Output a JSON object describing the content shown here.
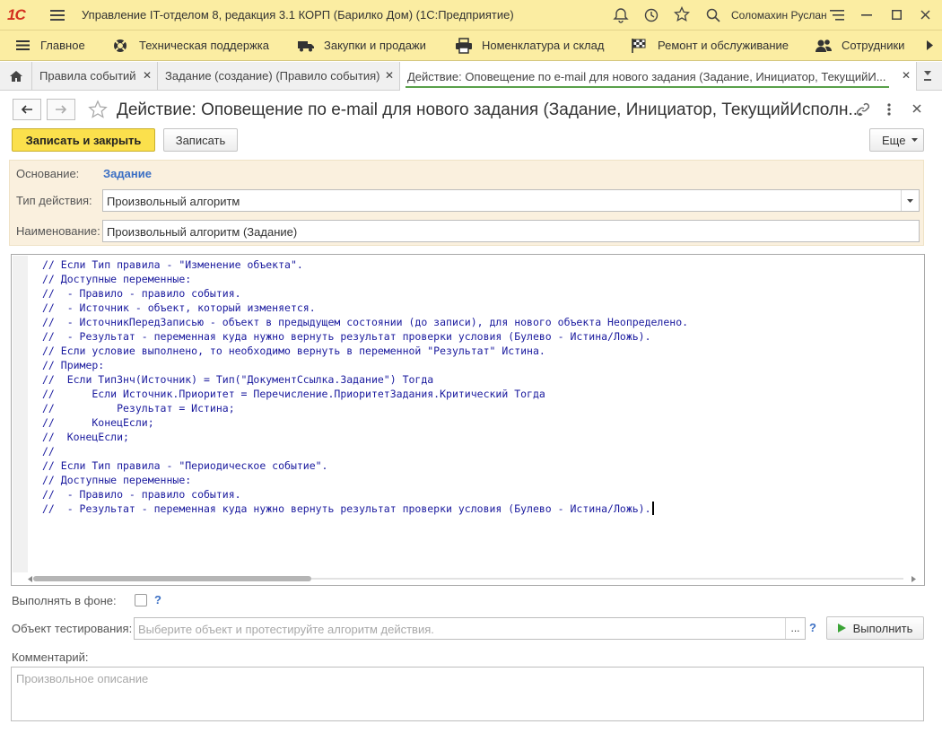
{
  "app": {
    "logo": "1С",
    "title": "Управление IT-отделом 8, редакция 3.1 КОРП (Барилко Дом)  (1С:Предприятие)",
    "user": "Соломахин Руслан"
  },
  "sections": [
    {
      "label": "Главное",
      "icon": "menu-icon"
    },
    {
      "label": "Техническая поддержка",
      "icon": "lifebuoy-icon"
    },
    {
      "label": "Закупки и продажи",
      "icon": "truck-icon"
    },
    {
      "label": "Номенклатура и склад",
      "icon": "printer-icon"
    },
    {
      "label": "Ремонт и обслуживание",
      "icon": "checkered-flag-icon"
    },
    {
      "label": "Сотрудники",
      "icon": "people-icon"
    }
  ],
  "tabs": [
    {
      "label": "Правила событий"
    },
    {
      "label": "Задание (создание) (Правило события)"
    },
    {
      "label": "Действие: Оповещение по e-mail для нового задания (Задание, Инициатор, ТекущийИ..."
    }
  ],
  "form": {
    "title": "Действие: Оповещение по e-mail для нового задания (Задание, Инициатор, ТекущийИсполн...",
    "save_close": "Записать и закрыть",
    "save": "Записать",
    "more": "Еще",
    "basis_label": "Основание:",
    "basis_value": "Задание",
    "action_type_label": "Тип действия:",
    "action_type_value": "Произвольный алгоритм",
    "name_label": "Наименование:",
    "name_value": "Произвольный алгоритм (Задание)"
  },
  "code_lines": [
    "// Если Тип правила - \"Изменение объекта\".",
    "// Доступные переменные:",
    "//  - Правило - правило события.",
    "//  - Источник - объект, который изменяется.",
    "//  - ИсточникПередЗаписью - объект в предыдущем состоянии (до записи), для нового объекта Неопределено.",
    "//  - Результат - переменная куда нужно вернуть результат проверки условия (Булево - Истина/Ложь).",
    "// Если условие выполнено, то необходимо вернуть в переменной \"Результат\" Истина.",
    "// Пример:",
    "//  Если ТипЗнч(Источник) = Тип(\"ДокументСсылка.Задание\") Тогда",
    "//      Если Источник.Приоритет = Перечисление.ПриоритетЗадания.Критический Тогда",
    "//          Результат = Истина;",
    "//      КонецЕсли;",
    "//  КонецЕсли;",
    "//",
    "// Если Тип правила - \"Периодическое событие\".",
    "// Доступные переменные:",
    "//  - Правило - правило события.",
    "//  - Результат - переменная куда нужно вернуть результат проверки условия (Булево - Истина/Ложь)."
  ],
  "bottom": {
    "background_label": "Выполнять в фоне:",
    "help": "?",
    "test_object_label": "Объект тестирования:",
    "test_object_placeholder": "Выберите объект и протестируйте алгоритм действия.",
    "ellipsis": "...",
    "run": "Выполнить",
    "comment_label": "Комментарий:",
    "comment_placeholder": "Произвольное описание"
  },
  "colors": {
    "accent": "#fbe04c",
    "header_bg": "#fbeda2",
    "link": "#3b6fc4",
    "code": "#1a1a9e",
    "run_icon": "#3aa335"
  }
}
